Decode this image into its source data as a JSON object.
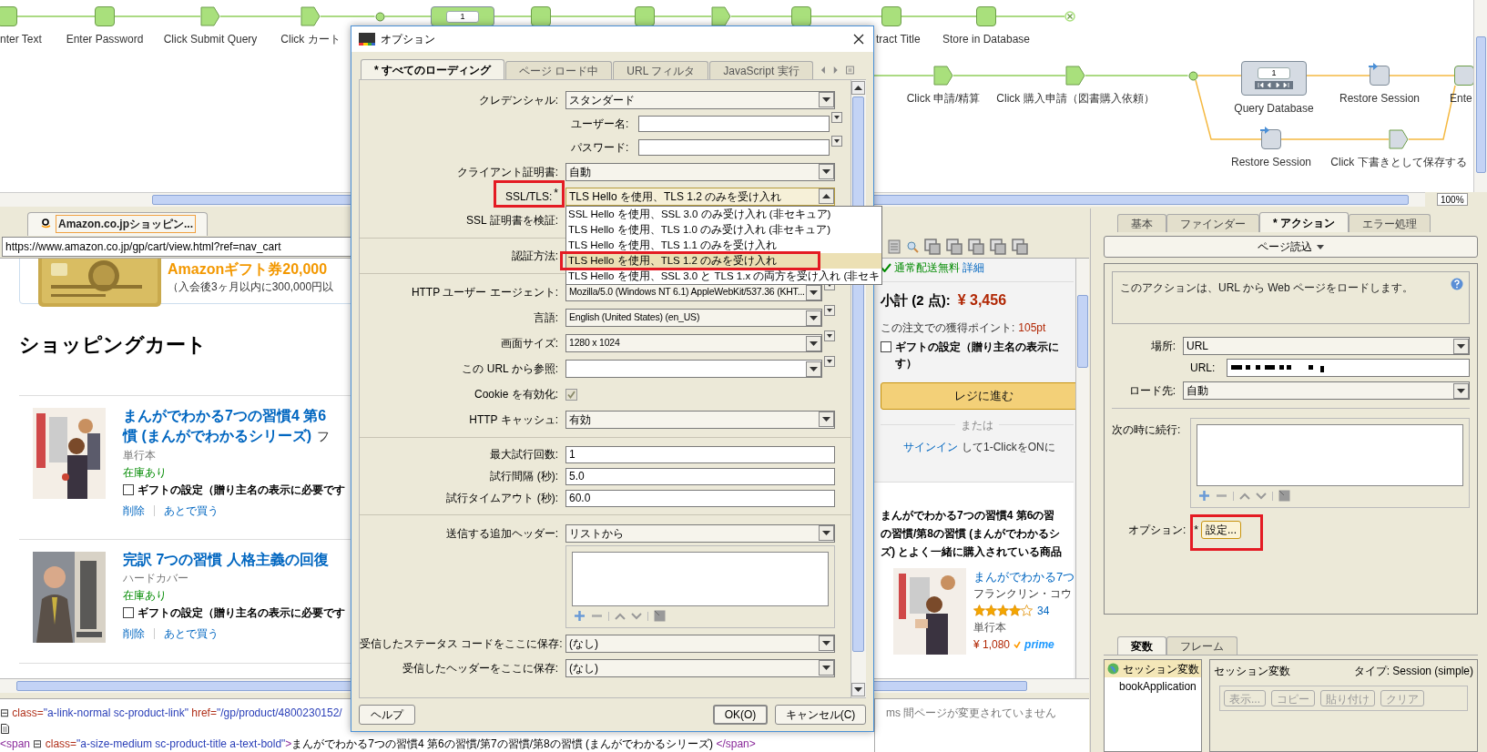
{
  "flow": {
    "nodes": [
      {
        "kind": "step",
        "label": "nter Text",
        "color": "#a9e07c"
      },
      {
        "kind": "step",
        "label": "Enter Password",
        "color": "#a9e07c"
      },
      {
        "kind": "click",
        "label": "Click Submit Query",
        "color": "#a9e07c"
      },
      {
        "kind": "click",
        "label": "Click カート",
        "color": "#a9e07c"
      },
      {
        "kind": "junction",
        "color": "#a9e07c"
      },
      {
        "kind": "loop",
        "counter": "1",
        "color": "#a9e07c"
      },
      {
        "kind": "step",
        "color": "#a9e07c"
      },
      {
        "kind": "step",
        "color": "#a9e07c"
      },
      {
        "kind": "click",
        "color": "#a9e07c"
      },
      {
        "kind": "step",
        "color": "#a9e07c"
      },
      {
        "kind": "step",
        "label": "tract Title",
        "color": "#a9e07c"
      },
      {
        "kind": "step",
        "label": "Store in Database",
        "color": "#a9e07c"
      },
      {
        "kind": "end",
        "color": "#a9e07c"
      },
      {
        "kind": "click",
        "label": "Click 申請/精算",
        "color": "#a9e07c"
      },
      {
        "kind": "click",
        "label": "Click 購入申請（図書購入依頼）",
        "color": "#a9e07c"
      },
      {
        "kind": "junction",
        "color": "#a9e07c"
      },
      {
        "kind": "query",
        "counter": "1",
        "label": "Query Database",
        "color": "#d5dbe3"
      },
      {
        "kind": "restore",
        "label": "Restore Session",
        "color": "#d5dbe3"
      },
      {
        "kind": "step",
        "label": "Ente",
        "color": "#d5dbe3"
      },
      {
        "kind": "restore",
        "label": "Restore Session",
        "color": "#d5dbe3"
      },
      {
        "kind": "click",
        "label": "Click 下書きとして保存する",
        "color": "#d5dbe3"
      }
    ],
    "zoom": "100%"
  },
  "browser": {
    "tab": {
      "title": "Amazon.co.jpショッピン...",
      "selected": true
    },
    "url": "https://www.amazon.co.jp/gp/cart/view.html?ref=nav_cart",
    "promo": {
      "headline": "Amazonギフト券20,000",
      "note": "（入会後3ヶ月以内に300,000円以"
    },
    "cart_title": "ショッピングカート",
    "items": [
      {
        "title_lines": [
          "まんがでわかる7つの習慣4 第6",
          "慣 (まんがでわかるシリーズ)"
        ],
        "author": "フ",
        "format": "単行本",
        "stock": "在庫あり",
        "gift": "ギフトの設定（贈り主名の表示に必要です",
        "gift_checked": false,
        "delete": "削除",
        "later": "あとで買う"
      },
      {
        "title_lines": [
          "完訳 7つの習慣 人格主義の回復"
        ],
        "format": "ハードカバー",
        "stock": "在庫あり",
        "gift": "ギフトの設定（贈り主名の表示に必要です",
        "gift_checked": false,
        "delete": "削除",
        "later": "あとで買う"
      }
    ],
    "summary": {
      "shipping": "通常配送無料",
      "shipping_link": "詳細",
      "subtotal_label": "小計 (2 点):",
      "subtotal": "¥ 3,456",
      "points_label": "この注文での獲得ポイント:",
      "points": "105pt",
      "gift_lines": [
        "ギフトの設定（贈り主名の表示に",
        "す）"
      ],
      "gift_checked": false,
      "checkout": "レジに進む",
      "or": "または",
      "signin": "サインイン",
      "signin_rest": "して1-ClickをONに"
    },
    "related": {
      "heading_lines": [
        "まんがでわかる7つの習慣4 第6の習",
        "の習慣/第8の習慣 (まんがでわかるシ",
        "ズ) とよく一緒に購入されている商品"
      ],
      "title": "まんがでわかる7つ",
      "author": "フランクリン・コウ",
      "stars": 4,
      "rating_count": "34",
      "format": "単行本",
      "price": "¥ 1,080",
      "prime": "prime"
    }
  },
  "source": {
    "lines": [
      [
        {
          "kind": "expander",
          "text": "⊟"
        },
        {
          "kind": "attr",
          "text": " class="
        },
        {
          "kind": "value",
          "text": "\"a-link-normal sc-product-link\""
        },
        {
          "kind": "attr",
          "text": " href="
        },
        {
          "kind": "value",
          "text": "\"/gp/product/4800230152/"
        }
      ],
      [
        {
          "kind": "doc"
        }
      ],
      [
        {
          "kind": "tag",
          "text": "<span "
        },
        {
          "kind": "expander",
          "text": "⊟"
        },
        {
          "kind": "attr",
          "text": " class="
        },
        {
          "kind": "value",
          "text": "\"a-size-medium sc-product-title a-text-bold\""
        },
        {
          "kind": "tag",
          "text": ">"
        },
        {
          "kind": "text",
          "text": "まんがでわかる7つの習慣4 第6の習慣/第7の習慣/第8の習慣 (まんがでわかるシリーズ) "
        },
        {
          "kind": "tag",
          "text": "</span>"
        }
      ]
    ],
    "status": "ms 間ページが変更されていません"
  },
  "dialog": {
    "title": "オプション",
    "tabs": [
      {
        "label": "* すべてのローディング",
        "selected": true
      },
      {
        "label": "ページ ロード中",
        "selected": false
      },
      {
        "label": "URL フィルタ",
        "selected": false
      },
      {
        "label": "JavaScript 実行",
        "selected": false
      }
    ],
    "fields": [
      {
        "kind": "select",
        "label": "クレデンシャル:",
        "value": "スタンダード"
      },
      {
        "kind": "subtext",
        "label": "ユーザー名:"
      },
      {
        "kind": "subtext",
        "label": "パスワード:"
      },
      {
        "kind": "select",
        "label": "クライアント証明書:",
        "value": "自動"
      },
      {
        "kind": "open_select",
        "label": "SSL/TLS:",
        "mark": "*",
        "highlighted": true,
        "value": "TLS Hello を使用、TLS 1.2 のみを受け入れ",
        "options": [
          {
            "label": "SSL Hello を使用、SSL 3.0 のみ受け入れ (非セキュア)",
            "selected": false,
            "highlighted": false
          },
          {
            "label": "TLS Hello を使用、TLS 1.0 のみ受け入れ (非セキュア)",
            "selected": false,
            "highlighted": false
          },
          {
            "label": "TLS Hello を使用、TLS 1.1 のみを受け入れ",
            "selected": false,
            "highlighted": false
          },
          {
            "label": "TLS Hello を使用、TLS 1.2 のみを受け入れ",
            "selected": true,
            "highlighted": true
          },
          {
            "label": "TLS Hello を使用、SSL 3.0 と TLS 1.x の両方を受け入れ (非セキ",
            "selected": false,
            "highlighted": false
          }
        ]
      },
      {
        "kind": "label",
        "label": "SSL 証明書を検証:"
      },
      {
        "kind": "divider"
      },
      {
        "kind": "label",
        "label": "認証方法:"
      },
      {
        "kind": "divider"
      },
      {
        "kind": "combo",
        "label": "HTTP ユーザー エージェント:",
        "value": "Mozilla/5.0 (Windows NT 6.1) AppleWebKit/537.36 (KHT..."
      },
      {
        "kind": "combo",
        "label": "言語:",
        "value": "English (United States) (en_US)"
      },
      {
        "kind": "combo",
        "label": "画面サイズ:",
        "value": "1280 x 1024"
      },
      {
        "kind": "combo",
        "label": "この URL から参照:"
      },
      {
        "kind": "checkbox",
        "label": "Cookie を有効化:",
        "checked": true
      },
      {
        "kind": "select",
        "label": "HTTP キャッシュ:",
        "value": "有効"
      },
      {
        "kind": "divider"
      },
      {
        "kind": "text",
        "label": "最大試行回数:",
        "value": "1"
      },
      {
        "kind": "text",
        "label": "試行間隔 (秒):",
        "value": "5.0"
      },
      {
        "kind": "text",
        "label": "試行タイムアウト (秒):",
        "value": "60.0"
      },
      {
        "kind": "divider"
      },
      {
        "kind": "select",
        "label": "送信する追加ヘッダー:",
        "value": "リストから"
      },
      {
        "kind": "listbox"
      },
      {
        "kind": "select",
        "label": "受信したステータス コードをここに保存:",
        "value": "(なし)"
      },
      {
        "kind": "select",
        "label": "受信したヘッダーをここに保存:",
        "value": "(なし)"
      }
    ],
    "buttons": [
      {
        "label": "ヘルプ",
        "kind": "left"
      },
      {
        "label": "OK(O)",
        "kind": "default"
      },
      {
        "label": "キャンセル(C)",
        "kind": "right"
      }
    ]
  },
  "action_panel": {
    "tabs": [
      {
        "label": "基本",
        "selected": false
      },
      {
        "label": "ファインダー",
        "selected": false
      },
      {
        "label": "* アクション",
        "selected": true
      },
      {
        "label": "エラー処理",
        "selected": false
      }
    ],
    "action_button": "ページ読込",
    "description": "このアクションは、URL から Web ページをロードします。",
    "location_label": "場所:",
    "location": "URL",
    "url_label": "URL:",
    "load_to_label": "ロード先:",
    "load_to": "自動",
    "continue_label": "次の時に続行:",
    "options_label": "オプション:",
    "options_mark": "*",
    "options_button": "設定...",
    "options_highlighted": true
  },
  "variables_panel": {
    "tabs": [
      {
        "label": "変数",
        "selected": true
      },
      {
        "label": "フレーム",
        "selected": false
      }
    ],
    "tree": [
      {
        "label": "セッション変数",
        "selected": true
      },
      {
        "label": "bookApplication",
        "selected": false
      }
    ],
    "header": "セッション変数",
    "type": "タイプ: Session (simple)",
    "buttons": [
      {
        "label": "表示...",
        "disabled": true
      },
      {
        "label": "コピー",
        "disabled": true
      },
      {
        "label": "貼り付け",
        "disabled": true
      },
      {
        "label": "クリア",
        "disabled": true
      }
    ]
  }
}
